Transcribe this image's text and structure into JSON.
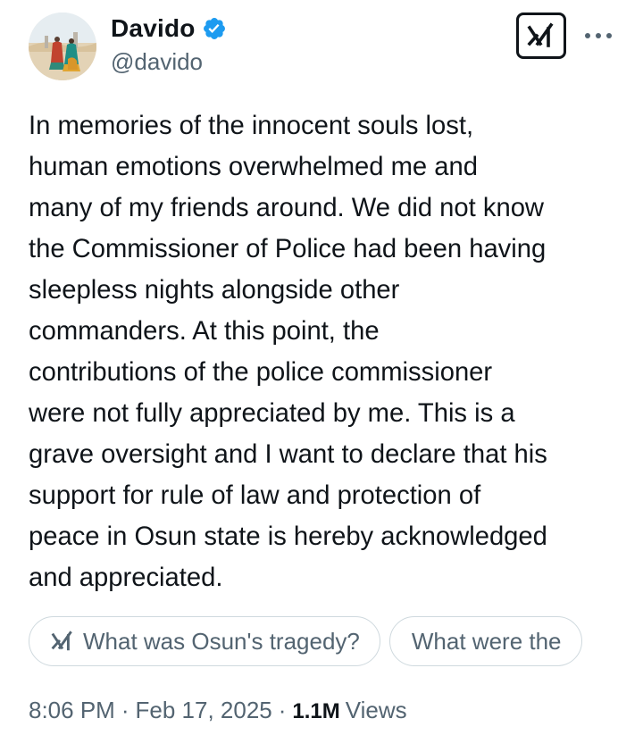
{
  "author": {
    "display_name": "Davido",
    "handle": "@davido",
    "verified": true,
    "verified_color": "#1d9bf0"
  },
  "header": {
    "grok_icon": "grok-icon",
    "more_icon": "more-options-icon"
  },
  "tweet": {
    "text": "In memories of the innocent souls lost,\nhuman emotions overwhelmed me and\nmany of my friends around. We did not know\nthe Commissioner of Police had been having\nsleepless nights alongside other\ncommanders. At this point, the\ncontributions of the police commissioner\nwere not fully appreciated by me. This is a\ngrave oversight and I want to declare that his\nsupport for rule of law and protection of\npeace in Osun state is hereby acknowledged\nand appreciated."
  },
  "grok_suggestions": [
    {
      "label": "What was Osun's tragedy?",
      "icon": "grok-icon"
    },
    {
      "label": "What were the"
    }
  ],
  "meta": {
    "time": "8:06 PM",
    "separator": "·",
    "date": "Feb 17, 2025",
    "views_count": "1.1M",
    "views_label": "Views"
  }
}
